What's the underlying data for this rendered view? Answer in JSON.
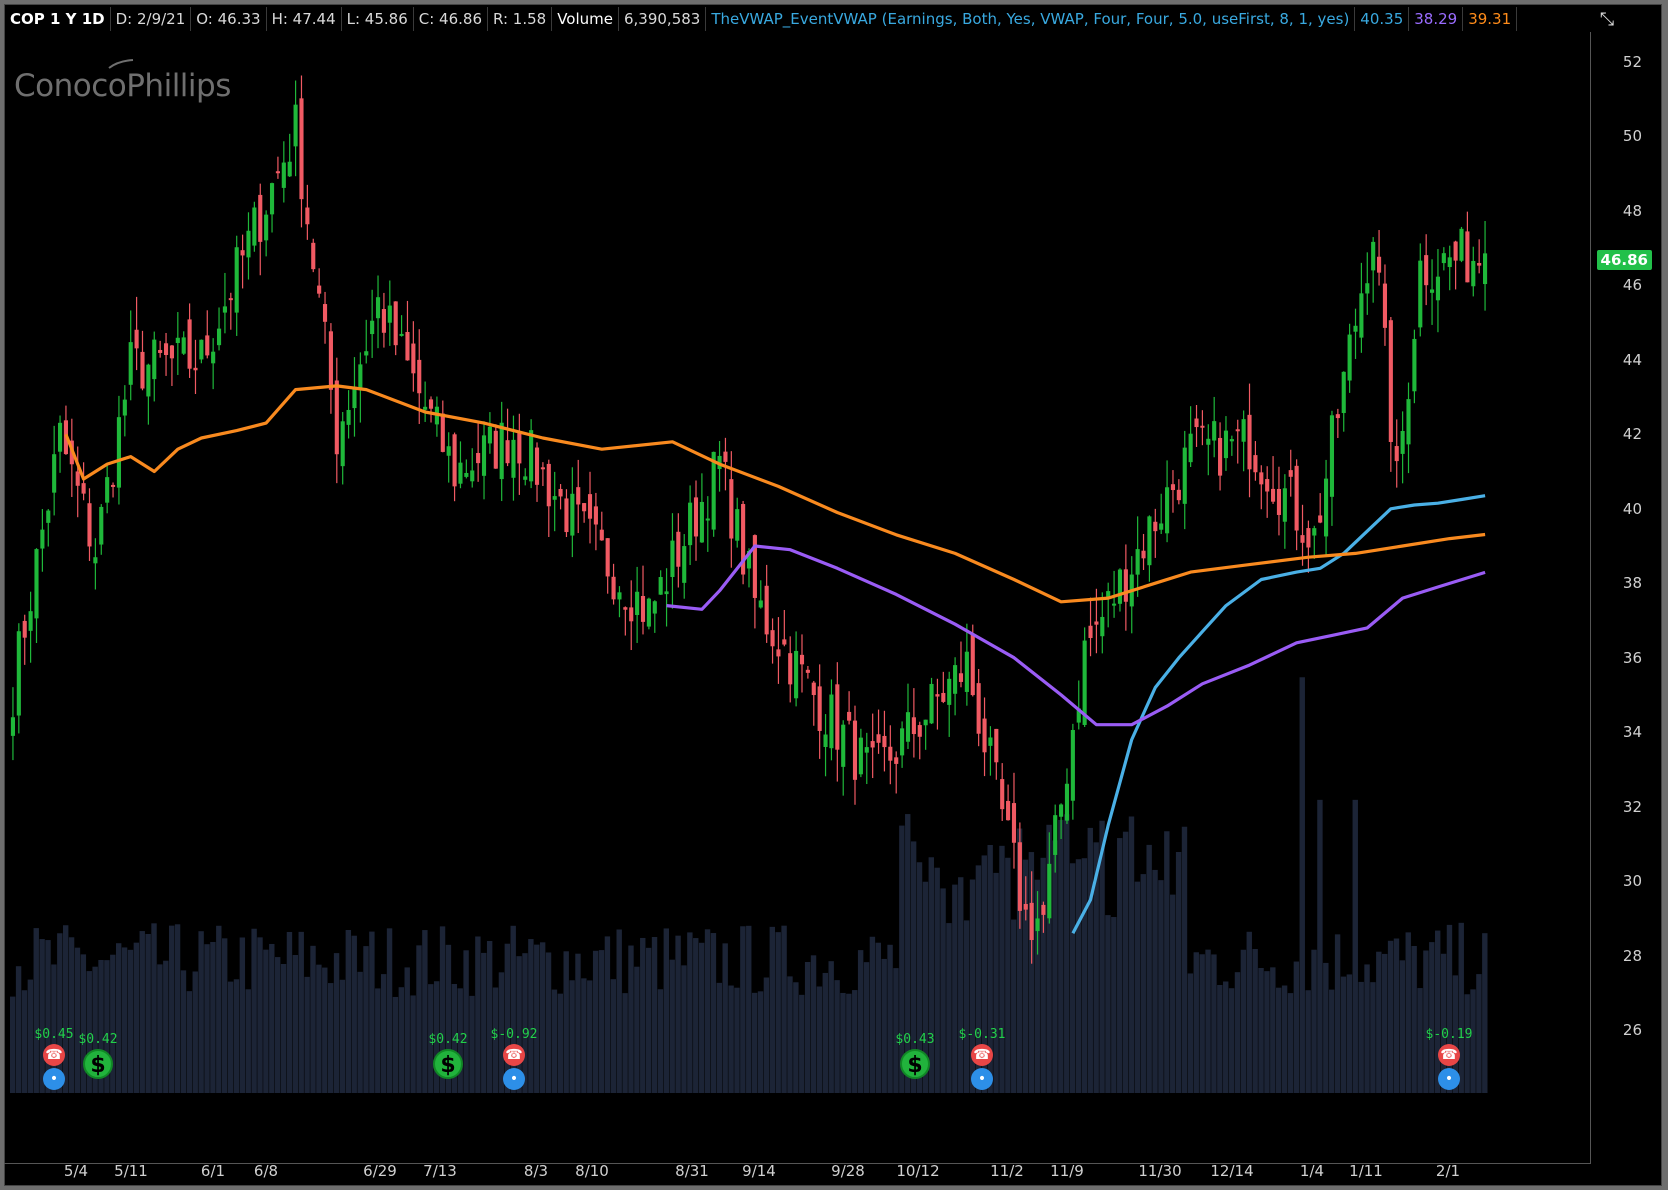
{
  "header": {
    "symbol": "COP 1 Y 1D",
    "date": "D: 2/9/21",
    "open": "O: 46.33",
    "high": "H: 47.44",
    "low": "L: 45.86",
    "close": "C: 46.86",
    "range": "R: 1.58",
    "volume_label": "Volume",
    "volume_value": "6,390,583",
    "study": "TheVWAP_EventVWAP (Earnings, Both, Yes, VWAP, Four, Four, 5.0, useFirst, 8, 1, yes)",
    "study_val1": "40.35",
    "study_val2": "38.29",
    "study_val3": "39.31"
  },
  "logo_text": "ConocoPhillips",
  "last_price": "46.86",
  "colors": {
    "up": "#1fb83a",
    "down": "#f05a63",
    "vwap_blue": "#4ab0e6",
    "vwap_purple": "#9a5cf5",
    "vwap_orange": "#f98a1f",
    "volume": "#1c2436"
  },
  "events": [
    {
      "type": "earnings",
      "amount": "$0.45",
      "icons": [
        "phone-icon",
        "bulb-icon"
      ]
    },
    {
      "type": "dividend",
      "amount": "$0.42",
      "icons": [
        "dollar-icon"
      ]
    },
    {
      "type": "dividend",
      "amount": "$0.42",
      "icons": [
        "dollar-icon"
      ]
    },
    {
      "type": "earnings",
      "amount": "$-0.92",
      "icons": [
        "phone-icon",
        "bulb-icon"
      ]
    },
    {
      "type": "dividend",
      "amount": "$0.43",
      "icons": [
        "dollar-icon"
      ]
    },
    {
      "type": "earnings",
      "amount": "$-0.31",
      "icons": [
        "phone-icon",
        "bulb-icon"
      ]
    },
    {
      "type": "earnings",
      "amount": "$-0.19",
      "icons": [
        "phone-icon",
        "bulb-icon"
      ]
    }
  ],
  "chart_data": {
    "type": "candlestick",
    "title": "COP 1 Y 1D",
    "y_ticks": [
      26,
      28,
      30,
      32,
      34,
      36,
      38,
      40,
      42,
      44,
      46,
      48,
      50,
      52
    ],
    "ylim": [
      24.6,
      52.8
    ],
    "x_ticks": [
      "5/4",
      "5/11",
      "6/1",
      "6/8",
      "6/29",
      "7/13",
      "8/3",
      "8/10",
      "8/31",
      "9/14",
      "9/28",
      "10/12",
      "11/2",
      "11/9",
      "11/30",
      "12/14",
      "1/4",
      "1/11",
      "2/1"
    ],
    "anchors": {
      "days": [
        0,
        8,
        14,
        20,
        32,
        48,
        55,
        62,
        75,
        85,
        96,
        108,
        120,
        126,
        136,
        146,
        162,
        172,
        175,
        182,
        200,
        210,
        221,
        231,
        235,
        239,
        250
      ],
      "close": [
        35.2,
        41.9,
        38.9,
        43.8,
        44.0,
        50.2,
        42.0,
        45.5,
        41.0,
        42.0,
        39.5,
        37.2,
        41.2,
        37.5,
        35.0,
        32.8,
        35.8,
        29.0,
        29.0,
        36.2,
        41.5,
        41.8,
        39.2,
        47.6,
        40.6,
        46.5,
        46.86
      ]
    },
    "series": [
      {
        "name": "TheVWAP_EventVWAP",
        "value": 40.35,
        "start_day": 180,
        "days": [
          180,
          183,
          186,
          190,
          194,
          198,
          202,
          206,
          212,
          218,
          222,
          226,
          230,
          234,
          238,
          242,
          246,
          250
        ],
        "values": [
          28.6,
          29.5,
          31.5,
          33.8,
          35.2,
          36.0,
          36.7,
          37.4,
          38.1,
          38.3,
          38.4,
          38.8,
          39.4,
          40.0,
          40.1,
          40.15,
          40.25,
          40.35
        ]
      },
      {
        "name": "TheVWAP_EventVWAP",
        "value": 38.29,
        "start_day": 111,
        "days": [
          111,
          117,
          120,
          126,
          132,
          140,
          150,
          160,
          170,
          178,
          184,
          190,
          196,
          202,
          210,
          218,
          224,
          230,
          236,
          242,
          250
        ],
        "values": [
          37.4,
          37.3,
          37.8,
          39.0,
          38.9,
          38.4,
          37.7,
          36.9,
          36.0,
          35.0,
          34.2,
          34.2,
          34.7,
          35.3,
          35.8,
          36.4,
          36.6,
          36.8,
          37.6,
          37.9,
          38.29
        ]
      },
      {
        "name": "TheVWAP_EventVWAP",
        "value": 39.31,
        "start_day": 9,
        "days": [
          9,
          12,
          16,
          20,
          24,
          28,
          32,
          38,
          43,
          48,
          55,
          60,
          70,
          80,
          90,
          100,
          112,
          120,
          130,
          140,
          150,
          160,
          170,
          178,
          186,
          194,
          200,
          210,
          220,
          228,
          236,
          244,
          250
        ],
        "values": [
          42.0,
          40.8,
          41.2,
          41.4,
          41.0,
          41.6,
          41.9,
          42.1,
          42.3,
          43.2,
          43.3,
          43.2,
          42.6,
          42.3,
          41.9,
          41.6,
          41.8,
          41.2,
          40.6,
          39.9,
          39.3,
          38.8,
          38.1,
          37.5,
          37.6,
          38.0,
          38.3,
          38.5,
          38.7,
          38.8,
          39.0,
          39.2,
          39.31
        ]
      }
    ],
    "volume": {
      "note": "relative bar heights",
      "max_frac": 0.62
    },
    "grid": false,
    "legend": "none"
  }
}
